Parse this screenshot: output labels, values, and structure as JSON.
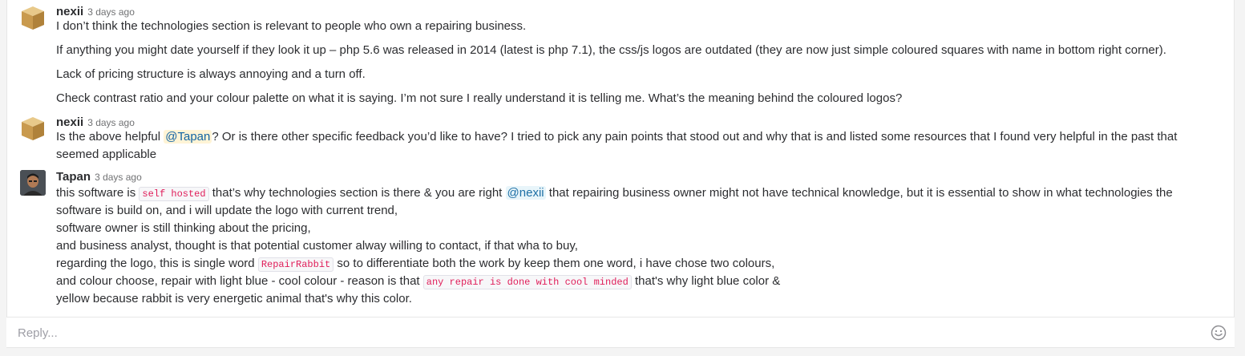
{
  "messages": [
    {
      "author": "nexii",
      "time": "3 days ago",
      "lines": [
        "I don’t think the technologies section is relevant to people who own a repairing business.",
        "If anything you might date yourself if they look it up – php 5.6 was released in 2014 (latest is php 7.1), the css/js logos are outdated (they are now just simple coloured squares with name in bottom right corner).",
        "Lack of pricing structure is always annoying and a turn off.",
        "Check contrast ratio and your colour palette on what it is saying. I’m not sure I really understand it is telling me. What’s the meaning behind the coloured logos?"
      ]
    },
    {
      "author": "nexii",
      "time": "3 days ago",
      "l1_a": "Is the above helpful ",
      "mention": "@Tapan",
      "l1_b": "? Or is there other specific feedback you’d like to have? I tried to pick any pain points that stood out and why that is and listed some resources that I found very helpful in the past that",
      "l2": "seemed applicable"
    },
    {
      "author": "Tapan",
      "time": "3 days ago",
      "l1_a": "this software is ",
      "code1": "self hosted",
      "l1_b": " that’s why technologies section is there & you are right ",
      "mention": "@nexii",
      "l1_c": " that repairing business owner might not have technical knowledge, but it is essential to show in what technologies the",
      "l2": "software is build on, and i will update the logo with current trend,",
      "l3": "software owner is still thinking about the pricing,",
      "l4": "and business analyst, thought is that potential customer alway willing to contact, if that wha to buy,",
      "l5_a": "regarding the logo, this is single word ",
      "code2": "RepairRabbit",
      "l5_b": " so to differentiate both the work by keep them  one word, i have chose two colours,",
      "l6_a": "and colour choose, repair with light blue - cool colour  - reason is that ",
      "code3": "any repair is done with cool minded",
      "l6_b": " that's why light blue color &",
      "l7": "yellow because rabbit is very energetic animal that's why this color."
    }
  ],
  "reply": {
    "placeholder": "Reply..."
  },
  "icons": {
    "emoji": "smiley-icon",
    "avatar1": "cardboard-box-avatar",
    "avatar3": "user-photo-avatar"
  }
}
